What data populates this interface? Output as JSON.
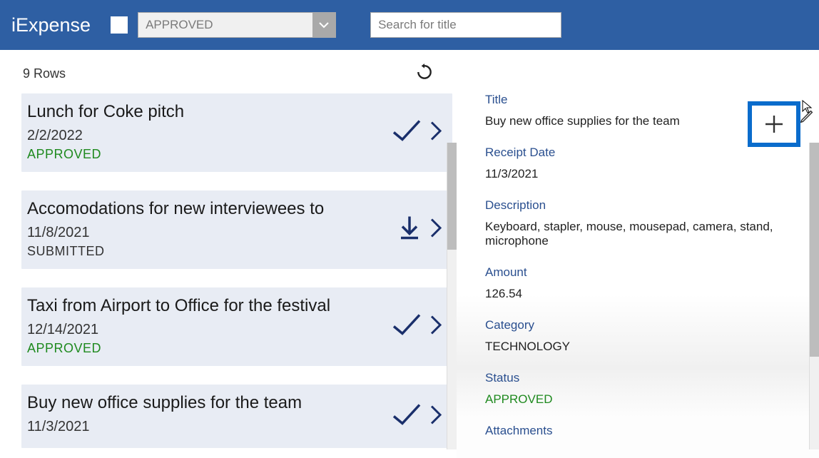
{
  "app": {
    "title": "iExpense"
  },
  "header": {
    "filter_checkbox_checked": false,
    "filter_dropdown_value": "APPROVED",
    "search_placeholder": "Search for title"
  },
  "list": {
    "row_count_label": "9 Rows",
    "items": [
      {
        "title": "Lunch for Coke pitch",
        "date": "2/2/2022",
        "status": "APPROVED",
        "status_class": "approved",
        "icon": "check"
      },
      {
        "title": "Accomodations for new interviewees to",
        "date": "11/8/2021",
        "status": "SUBMITTED",
        "status_class": "submitted",
        "icon": "download"
      },
      {
        "title": "Taxi from Airport to Office for the festival",
        "date": "12/14/2021",
        "status": "APPROVED",
        "status_class": "approved",
        "icon": "check"
      },
      {
        "title": "Buy new office supplies for the team",
        "date": "11/3/2021",
        "status": "",
        "status_class": "",
        "icon": "check"
      }
    ]
  },
  "detail": {
    "labels": {
      "title": "Title",
      "receipt_date": "Receipt Date",
      "description": "Description",
      "amount": "Amount",
      "category": "Category",
      "status": "Status",
      "attachments": "Attachments"
    },
    "values": {
      "title": "Buy new office supplies for the team",
      "receipt_date": "11/3/2021",
      "description": "Keyboard, stapler, mouse, mousepad, camera, stand, microphone",
      "amount": "126.54",
      "category": "TECHNOLOGY",
      "status": "APPROVED"
    }
  }
}
